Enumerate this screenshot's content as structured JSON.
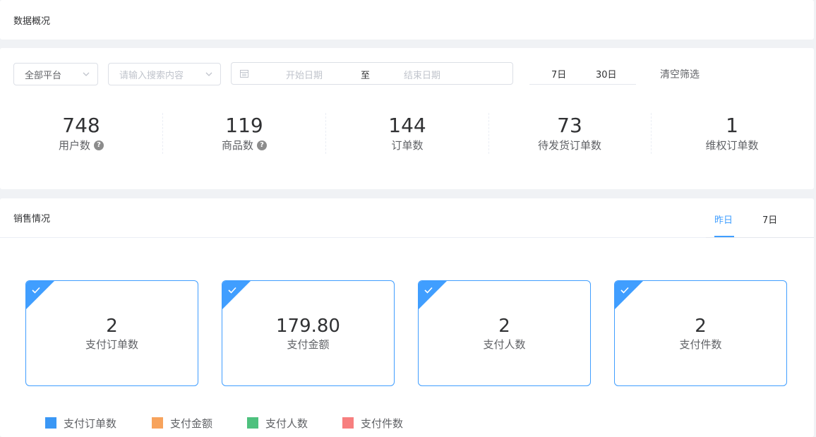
{
  "overview": {
    "title": "数据概况"
  },
  "filters": {
    "platform": "全部平台",
    "search_placeholder": "请输入搜索内容",
    "date_start_placeholder": "开始日期",
    "date_separator": "至",
    "date_end_placeholder": "结束日期",
    "quick_7": "7日",
    "quick_30": "30日",
    "clear": "清空筛选"
  },
  "stats": [
    {
      "value": "748",
      "label": "用户数",
      "help": true
    },
    {
      "value": "119",
      "label": "商品数",
      "help": true
    },
    {
      "value": "144",
      "label": "订单数",
      "help": false
    },
    {
      "value": "73",
      "label": "待发货订单数",
      "help": false
    },
    {
      "value": "1",
      "label": "维权订单数",
      "help": false
    }
  ],
  "help_glyph": "?",
  "sales": {
    "title": "销售情况",
    "tabs": [
      {
        "label": "昨日",
        "active": true
      },
      {
        "label": "7日",
        "active": false
      }
    ],
    "metrics": [
      {
        "value": "2",
        "label": "支付订单数"
      },
      {
        "value": "179.80",
        "label": "支付金额"
      },
      {
        "value": "2",
        "label": "支付人数"
      },
      {
        "value": "2",
        "label": "支付件数"
      }
    ],
    "legend": [
      {
        "label": "支付订单数",
        "color": "#3a97f5"
      },
      {
        "label": "支付金额",
        "color": "#f7a35c"
      },
      {
        "label": "支付人数",
        "color": "#4ec17e"
      },
      {
        "label": "支付件数",
        "color": "#f77f7f"
      }
    ]
  },
  "colors": {
    "accent": "#409eff",
    "page_bg": "#f0f2f5"
  }
}
